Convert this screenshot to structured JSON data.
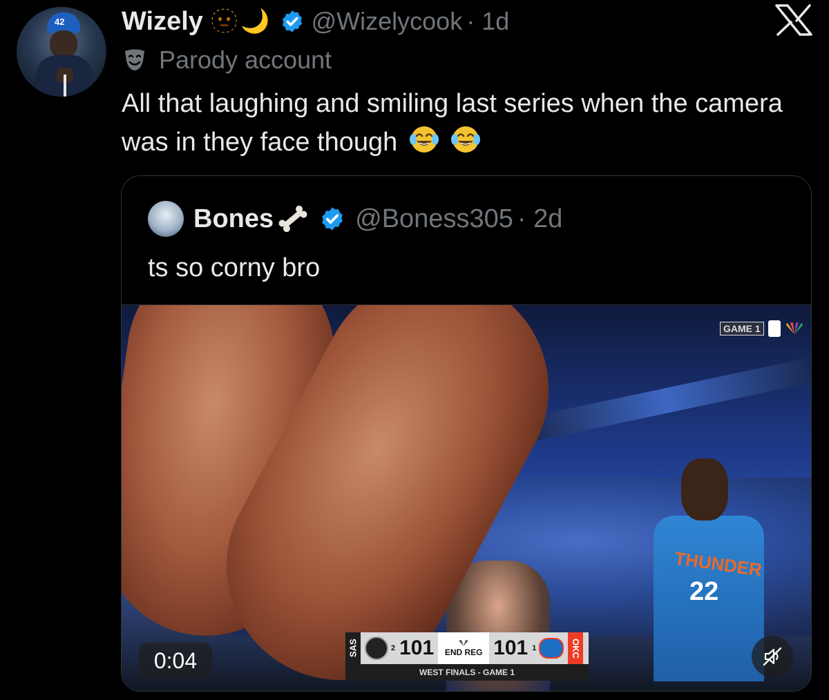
{
  "author": {
    "display_name": "Wizely",
    "emojis": [
      "🫥",
      "🌙"
    ],
    "handle": "@Wizelycook",
    "time": "· 1d",
    "avatar_cap_number": "42",
    "label": "Parody account"
  },
  "tweet": {
    "text": "All that laughing and smiling last series when the camera was in they face though"
  },
  "quoted": {
    "display_name": "Bones",
    "handle": "@Boness305",
    "time": "· 2d",
    "text": "ts so corny bro",
    "video": {
      "elapsed": "0:04",
      "game_tag": "GAME 1",
      "scorebug": {
        "away_team": "SAS",
        "away_score": "101",
        "away_series": "2",
        "status": "END REG",
        "home_score": "101",
        "home_series": "1",
        "home_team": "OKC",
        "subtitle": "WEST FINALS - GAME 1"
      },
      "player_name": "THUNDER",
      "player_number": "22"
    }
  },
  "colors": {
    "background": "#000000",
    "text": "#e7e9ea",
    "muted": "#71767b",
    "verified": "#1d9bf0",
    "border": "#2f3336"
  }
}
